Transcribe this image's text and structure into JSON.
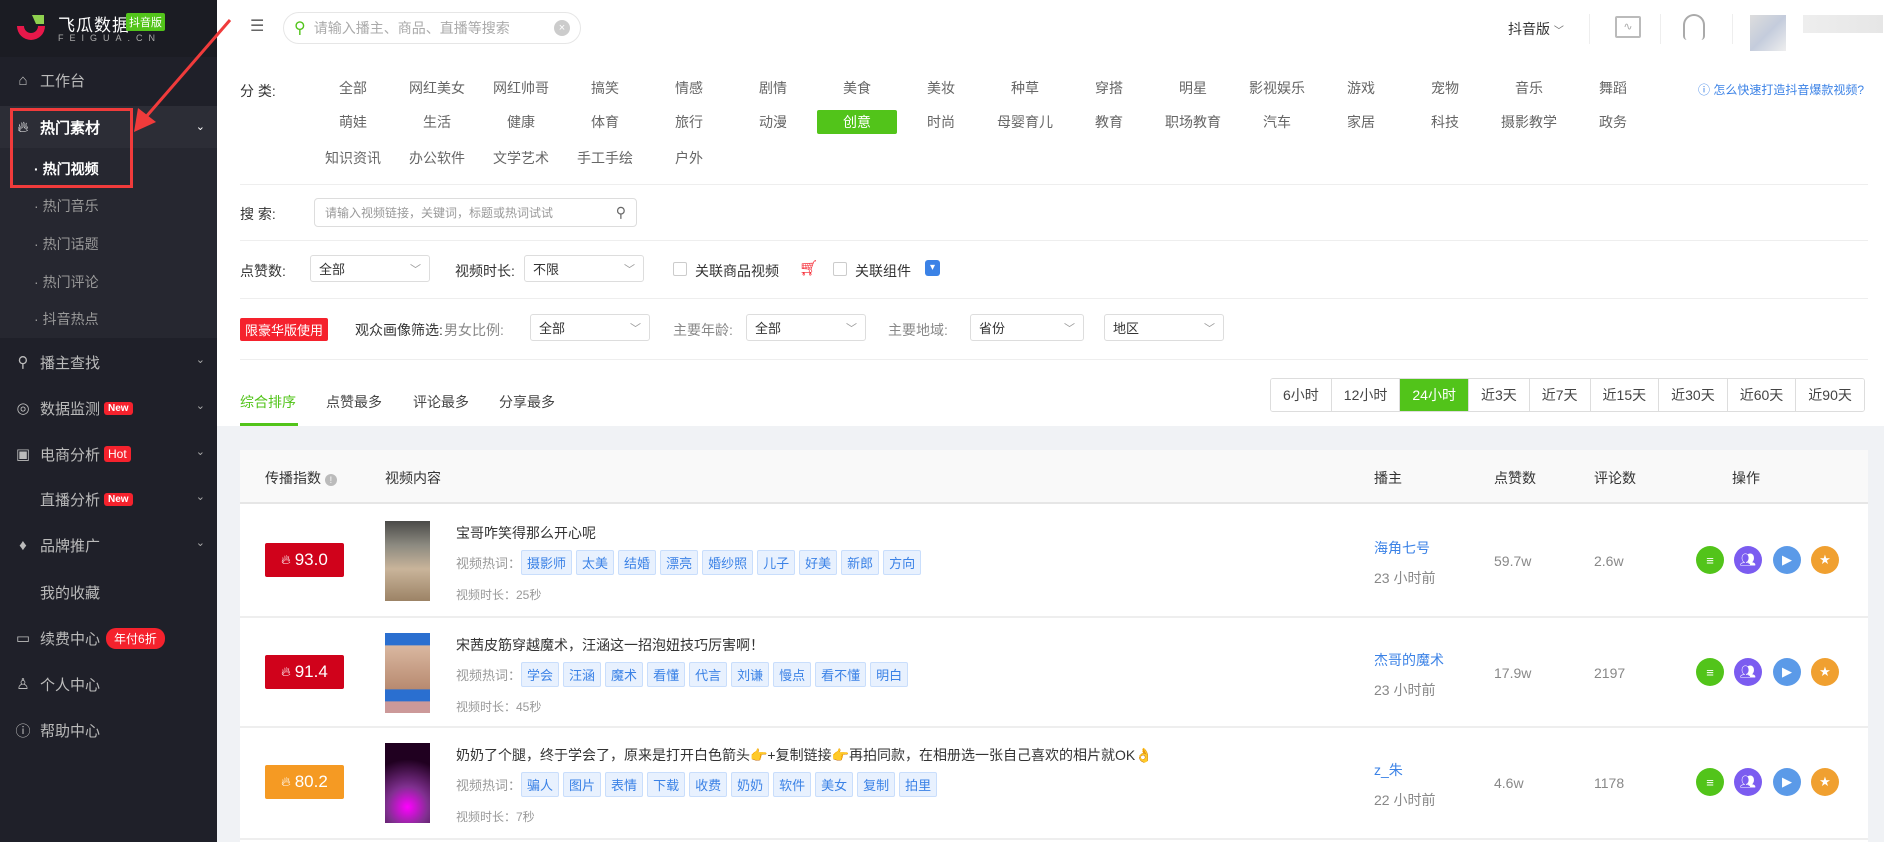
{
  "brand": {
    "name": "飞瓜数据",
    "edition": "抖音版",
    "domain": "FEIGUA.CN"
  },
  "header": {
    "search_placeholder": "请输入播主、商品、直播等搜索",
    "version": "抖音版"
  },
  "sidebar": {
    "items": [
      {
        "label": "工作台",
        "icon": "home-icon"
      },
      {
        "label": "热门素材",
        "icon": "fire-icon"
      },
      {
        "label": "播主查找",
        "icon": "search-icon"
      },
      {
        "label": "数据监测",
        "icon": "monitor-icon",
        "badge": "New"
      },
      {
        "label": "电商分析",
        "icon": "bag-icon",
        "badge": "Hot"
      },
      {
        "label": "直播分析",
        "badge": "New"
      },
      {
        "label": "品牌推广",
        "icon": "diamond-icon"
      },
      {
        "label": "我的收藏"
      },
      {
        "label": "续费中心",
        "icon": "card-icon",
        "badge": "年付6折"
      },
      {
        "label": "个人中心",
        "icon": "user-icon"
      },
      {
        "label": "帮助中心",
        "icon": "help-icon"
      }
    ],
    "sub": [
      "热门视频",
      "热门音乐",
      "热门话题",
      "热门评论",
      "抖音热点"
    ]
  },
  "filters": {
    "category_label": "分  类:",
    "categories": [
      "全部",
      "网红美女",
      "网红帅哥",
      "搞笑",
      "情感",
      "剧情",
      "美食",
      "美妆",
      "种草",
      "穿搭",
      "明星",
      "影视娱乐",
      "游戏",
      "宠物",
      "音乐",
      "舞蹈",
      "萌娃",
      "生活",
      "健康",
      "体育",
      "旅行",
      "动漫",
      "创意",
      "时尚",
      "母婴育儿",
      "教育",
      "职场教育",
      "汽车",
      "家居",
      "科技",
      "摄影教学",
      "政务",
      "知识资讯",
      "办公软件",
      "文学艺术",
      "手工手绘",
      "户外"
    ],
    "selected_category": "创意",
    "help_link": "怎么快速打造抖音爆款视频?",
    "search_label": "搜  索:",
    "search_placeholder": "请输入视频链接，关键词，标题或热词试试",
    "likes_label": "点赞数:",
    "likes_value": "全部",
    "duration_label": "视频时长:",
    "duration_value": "不限",
    "goods_label": "关联商品视频",
    "component_label": "关联组件",
    "premium_badge": "限豪华版使用",
    "audience_label": "观众画像筛选:",
    "gender_label": "男女比例:",
    "gender_value": "全部",
    "age_label": "主要年龄:",
    "age_value": "全部",
    "region_label": "主要地域:",
    "province_value": "省份",
    "area_value": "地区"
  },
  "sort_tabs": [
    "综合排序",
    "点赞最多",
    "评论最多",
    "分享最多"
  ],
  "time_ranges": [
    "6小时",
    "12小时",
    "24小时",
    "近3天",
    "近7天",
    "近15天",
    "近30天",
    "近60天",
    "近90天"
  ],
  "selected_time": "24小时",
  "table": {
    "headers": {
      "score": "传播指数",
      "content": "视频内容",
      "blogger": "播主",
      "likes": "点赞数",
      "comments": "评论数",
      "actions": "操作"
    },
    "keyword_label": "视频热词：",
    "rows": [
      {
        "score": "93.0",
        "score_color": "#d0021b",
        "title": "宝哥咋笑得那么开心呢",
        "keywords": [
          "摄影师",
          "太美",
          "结婚",
          "漂亮",
          "婚纱照",
          "儿子",
          "好美",
          "新郎",
          "方向"
        ],
        "duration": "视频时长：25秒",
        "blogger": "海角七号",
        "ago": "23 小时前",
        "likes": "59.7w",
        "comments": "2.6w"
      },
      {
        "score": "91.4",
        "score_color": "#d0021b",
        "title": "宋茜皮筋穿越魔术，汪涵这一招泡妞技巧厉害啊！",
        "keywords": [
          "学会",
          "汪涵",
          "魔术",
          "看懂",
          "代言",
          "刘谦",
          "慢点",
          "看不懂",
          "明白"
        ],
        "duration": "视频时长：45秒",
        "blogger": "杰哥的魔术",
        "ago": "23 小时前",
        "likes": "17.9w",
        "comments": "2197"
      },
      {
        "score": "80.2",
        "score_color": "#f59a23",
        "title": "奶奶了个腿，终于学会了，原来是打开白色箭头👉+复制链接👉再拍同款，在相册选一张自己喜欢的相片就OK👌",
        "keywords": [
          "骗人",
          "图片",
          "表情",
          "下载",
          "收费",
          "奶奶",
          "软件",
          "美女",
          "复制",
          "拍里"
        ],
        "duration": "视频时长：7秒",
        "blogger": "z_朱",
        "ago": "22 小时前",
        "likes": "4.6w",
        "comments": "1178"
      }
    ]
  },
  "colors": {
    "accent": "#52c41a",
    "link": "#3b82e6",
    "hot": "#f5222d"
  }
}
